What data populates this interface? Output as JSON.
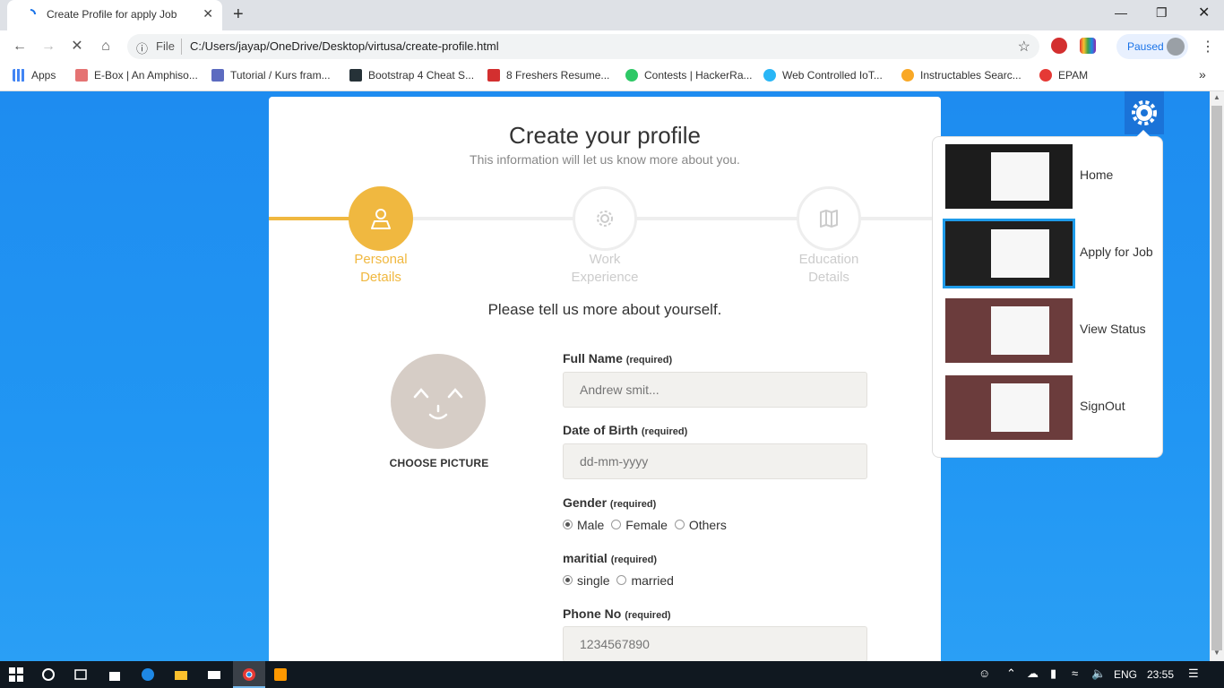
{
  "browser": {
    "tab_title": "Create Profile for apply Job",
    "tab_close": "✕",
    "new_tab": "+",
    "url_scheme": "File",
    "url": "C:/Users/jayap/OneDrive/Desktop/virtusa/create-profile.html",
    "profile_status": "Paused",
    "bookmarks": [
      {
        "label": "Apps",
        "color": "#4285f4"
      },
      {
        "label": "E-Box | An Amphiso...",
        "color": "#e57373"
      },
      {
        "label": "Tutorial / Kurs fram...",
        "color": "#5c6bc0"
      },
      {
        "label": "Bootstrap 4 Cheat S...",
        "color": "#263238"
      },
      {
        "label": "8 Freshers Resume...",
        "color": "#d32f2f"
      },
      {
        "label": "Contests | HackerRa...",
        "color": "#2ec866"
      },
      {
        "label": "Web Controlled IoT...",
        "color": "#29b6f6"
      },
      {
        "label": "Instructables Searc...",
        "color": "#f9a825"
      },
      {
        "label": "EPAM",
        "color": "#e53935"
      }
    ],
    "bookmarks_more": "»"
  },
  "form": {
    "title": "Create your profile",
    "subtitle": "This information will let us know more about you.",
    "progress": 0.167,
    "steps": [
      {
        "line1": "Personal",
        "line2": "Details",
        "active": true
      },
      {
        "line1": "Work",
        "line2": "Experience",
        "active": false
      },
      {
        "line1": "Education",
        "line2": "Details",
        "active": false
      }
    ],
    "prompt": "Please tell us more about yourself.",
    "choose_picture": "CHOOSE PICTURE",
    "required": "(required)",
    "full_name_label": "Full Name",
    "full_name_placeholder": "Andrew smit...",
    "dob_label": "Date of Birth",
    "dob_placeholder": "dd-mm-yyyy",
    "gender_label": "Gender",
    "gender_options": [
      "Male",
      "Female",
      "Others"
    ],
    "gender_selected": "Male",
    "marital_label": "maritial",
    "marital_options": [
      "single",
      "married"
    ],
    "marital_selected": "single",
    "phone_label": "Phone No",
    "phone_placeholder": "1234567890"
  },
  "menu": {
    "items": [
      {
        "label": "Home",
        "bg": "#1c1c1c"
      },
      {
        "label": "Apply for Job",
        "bg": "#202020",
        "selected": true
      },
      {
        "label": "View Status",
        "bg": "#6b3c3c"
      },
      {
        "label": "SignOut",
        "bg": "#6b3c3c"
      }
    ]
  },
  "taskbar": {
    "language": "ENG",
    "time": "23:55"
  },
  "colors": {
    "accent": "#f0b840",
    "page_bg": "#2196f3",
    "menu_selected": "#1e9be9"
  }
}
